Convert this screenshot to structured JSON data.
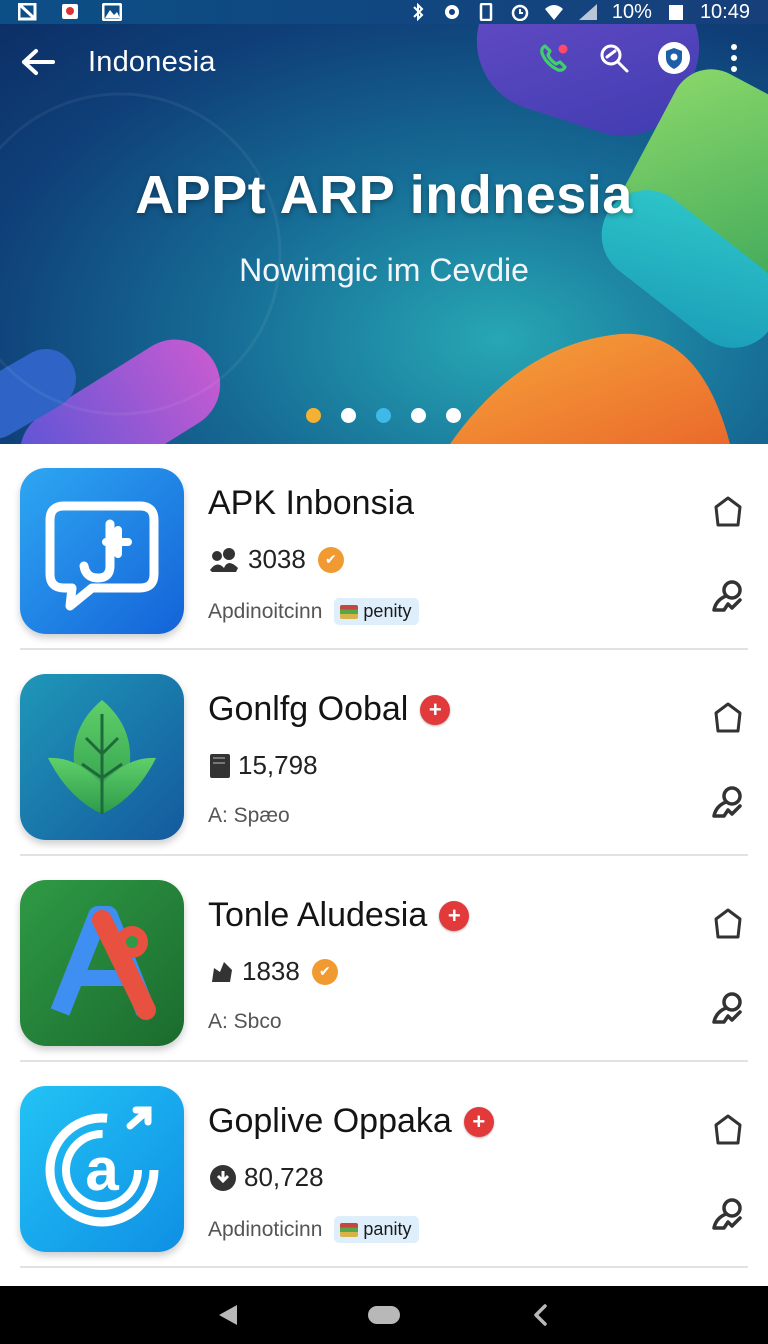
{
  "status_bar": {
    "battery": "10%",
    "time": "10:49",
    "icons": [
      "notification-icon",
      "bluetooth-icon",
      "alarm-icon",
      "wifi-icon",
      "signal-icon",
      "battery-icon"
    ]
  },
  "app_bar": {
    "title": "Indonesia",
    "actions": [
      "phone-icon",
      "search-icon",
      "shield-icon",
      "more-vert-icon"
    ]
  },
  "hero": {
    "title": "APPt ARP indnesia",
    "subtitle": "Nowimgic im Cevdie",
    "dots": [
      {
        "color": "#f5b133"
      },
      {
        "color": "#ffffff"
      },
      {
        "color": "#3fb9e8"
      },
      {
        "color": "#ffffff"
      },
      {
        "color": "#ffffff"
      }
    ]
  },
  "apps": [
    {
      "name": "APK Inbonsia",
      "stat": "3038",
      "meta": "Apdinoitcinn",
      "chip": "penity",
      "has_red_badge": false,
      "has_orange_badge": true
    },
    {
      "name": "Gonlfg Oobal",
      "stat": "15,798",
      "meta": "A: Spæo",
      "chip": "",
      "has_red_badge": true,
      "has_orange_badge": false
    },
    {
      "name": "Tonle Aludesia",
      "stat": "1838",
      "meta": "A: Sbco",
      "chip": "",
      "has_red_badge": true,
      "has_orange_badge": true
    },
    {
      "name": "Goplive Oppaka",
      "stat": "80,728",
      "meta": "Apdinoticinn",
      "chip": "panity",
      "has_red_badge": true,
      "has_orange_badge": false
    }
  ],
  "nav": [
    "back-icon",
    "home-icon",
    "recents-icon"
  ],
  "colors": {
    "accent_orange": "#f29a32",
    "badge_red": "#e23a3a",
    "chip_bg": "#dfeefb"
  }
}
